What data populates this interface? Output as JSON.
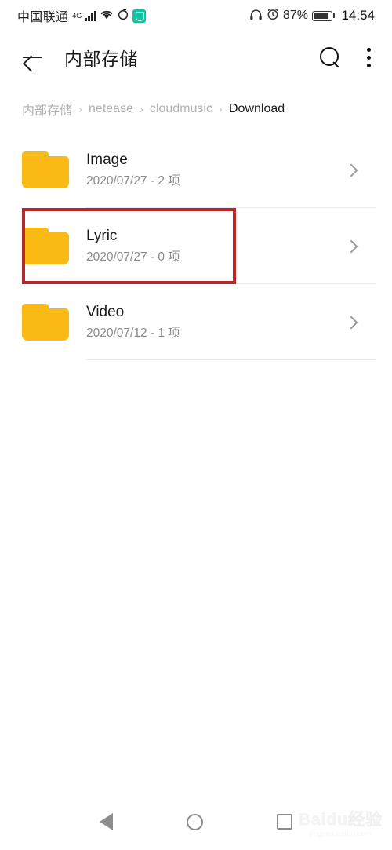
{
  "status_bar": {
    "carrier": "中国联通",
    "network_type": "4G",
    "icons": [
      "signal-bars-icon",
      "wifi-icon",
      "data-saver-icon",
      "miui-security-icon",
      "headphone-icon",
      "alarm-icon"
    ],
    "battery_percent": "87%",
    "battery_level": 87,
    "clock": "14:54"
  },
  "app_bar": {
    "title": "内部存储",
    "back_label": "back-arrow-icon",
    "search_label": "search-icon",
    "menu_label": "overflow-menu-icon"
  },
  "breadcrumb": {
    "separator": "›",
    "items": [
      {
        "label": "内部存储",
        "current": false
      },
      {
        "label": "netease",
        "current": false
      },
      {
        "label": "cloudmusic",
        "current": false
      },
      {
        "label": "Download",
        "current": true
      }
    ]
  },
  "file_list": [
    {
      "name": "Image",
      "subtitle": "2020/07/27 - 2 项",
      "date": "2020/07/27",
      "count": "2 项",
      "type": "folder",
      "highlighted": false
    },
    {
      "name": "Lyric",
      "subtitle": "2020/07/27 - 0 项",
      "date": "2020/07/27",
      "count": "0 项",
      "type": "folder",
      "highlighted": true
    },
    {
      "name": "Video",
      "subtitle": "2020/07/12 - 1 项",
      "date": "2020/07/12",
      "count": "1 项",
      "type": "folder",
      "highlighted": false
    }
  ],
  "annotation": {
    "color": "#b5282c",
    "target": "Lyric"
  },
  "nav_bar": {
    "back": "nav-back-icon",
    "home": "nav-home-icon",
    "recents": "nav-recents-icon"
  },
  "watermark": {
    "main": "Baidu经验",
    "sub": "jingyan.baidu.com"
  },
  "colors": {
    "folder": "#fbb914",
    "folder_light": "#fdd06a",
    "accent_red": "#b5282c",
    "miui_teal": "#14c2a0",
    "text_primary": "#1b1b1b",
    "text_secondary": "#8a8a8a",
    "text_muted": "#b0b0b0"
  }
}
